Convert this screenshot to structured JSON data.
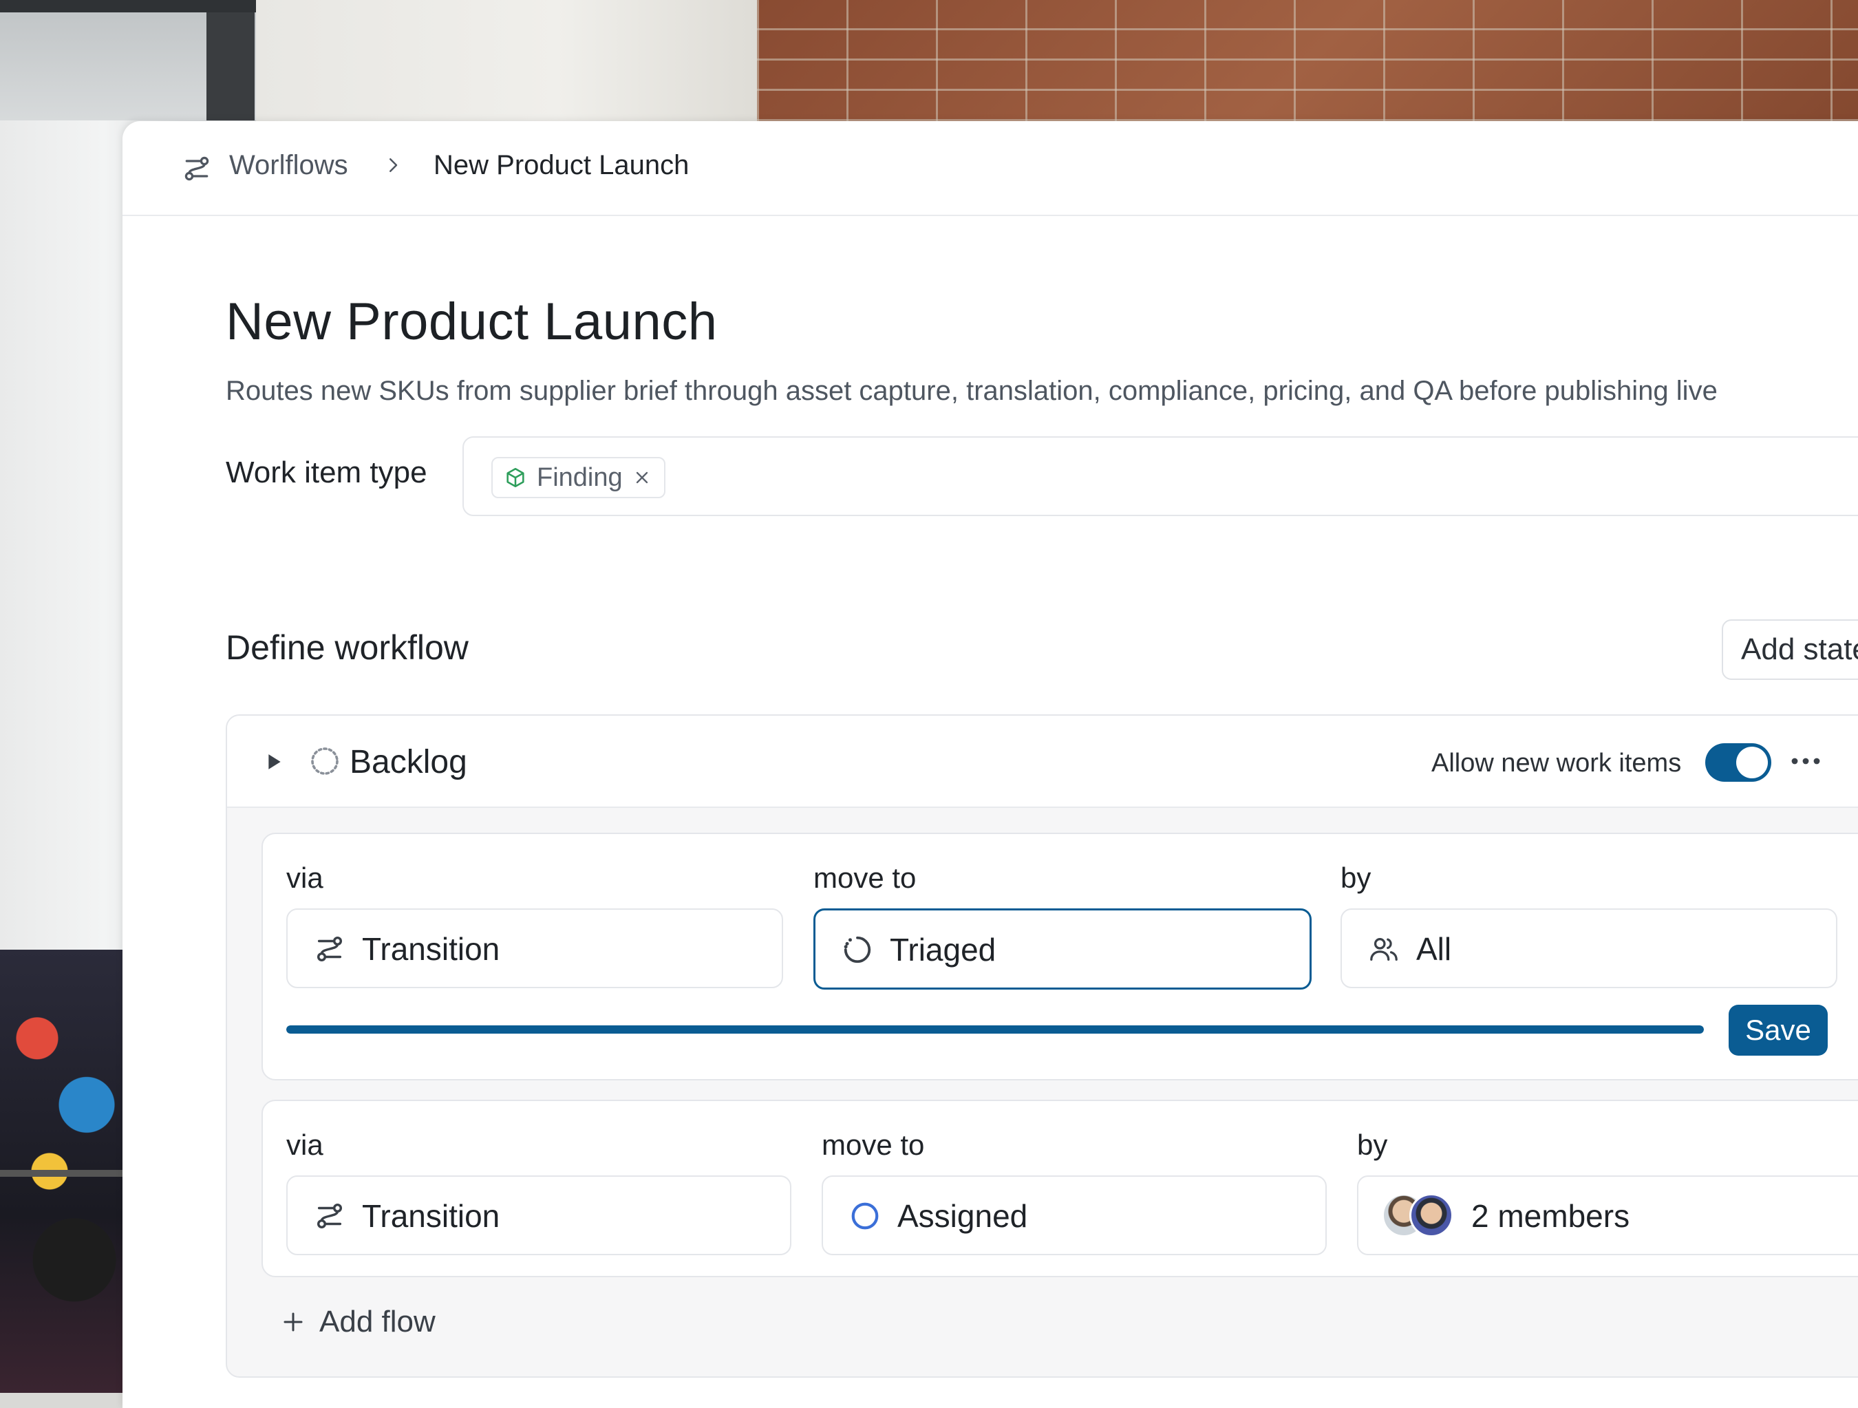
{
  "breadcrumb": {
    "root_label": "Worlflows",
    "current_label": "New Product Launch"
  },
  "page": {
    "title": "New Product Launch",
    "description": "Routes new SKUs from supplier brief through asset capture, translation, compliance, pricing, and QA before publishing live"
  },
  "work_item_type": {
    "label": "Work item type",
    "chips": [
      {
        "label": "Finding",
        "icon": "cube-icon"
      }
    ]
  },
  "workflow": {
    "heading": "Define workflow",
    "add_state_label": "Add state",
    "states": [
      {
        "name": "Backlog",
        "icon": "dashed-circle-icon",
        "allow_label": "Allow new work items",
        "allow_enabled": true,
        "flows": [
          {
            "via_label": "via",
            "move_to_label": "move to",
            "by_label": "by",
            "via_value": "Transition",
            "move_to_value": "Triaged",
            "by_value": "All",
            "progress_fraction": 1.0,
            "save_label": "Save"
          },
          {
            "via_label": "via",
            "move_to_label": "move to",
            "by_label": "by",
            "via_value": "Transition",
            "move_to_value": "Assigned",
            "by_value": "2 members"
          }
        ],
        "add_flow_label": "Add flow"
      }
    ]
  },
  "colors": {
    "accent": "#0a5c93",
    "chip_icon": "#2e9e5b",
    "assigned_ring": "#3b6fd8"
  }
}
